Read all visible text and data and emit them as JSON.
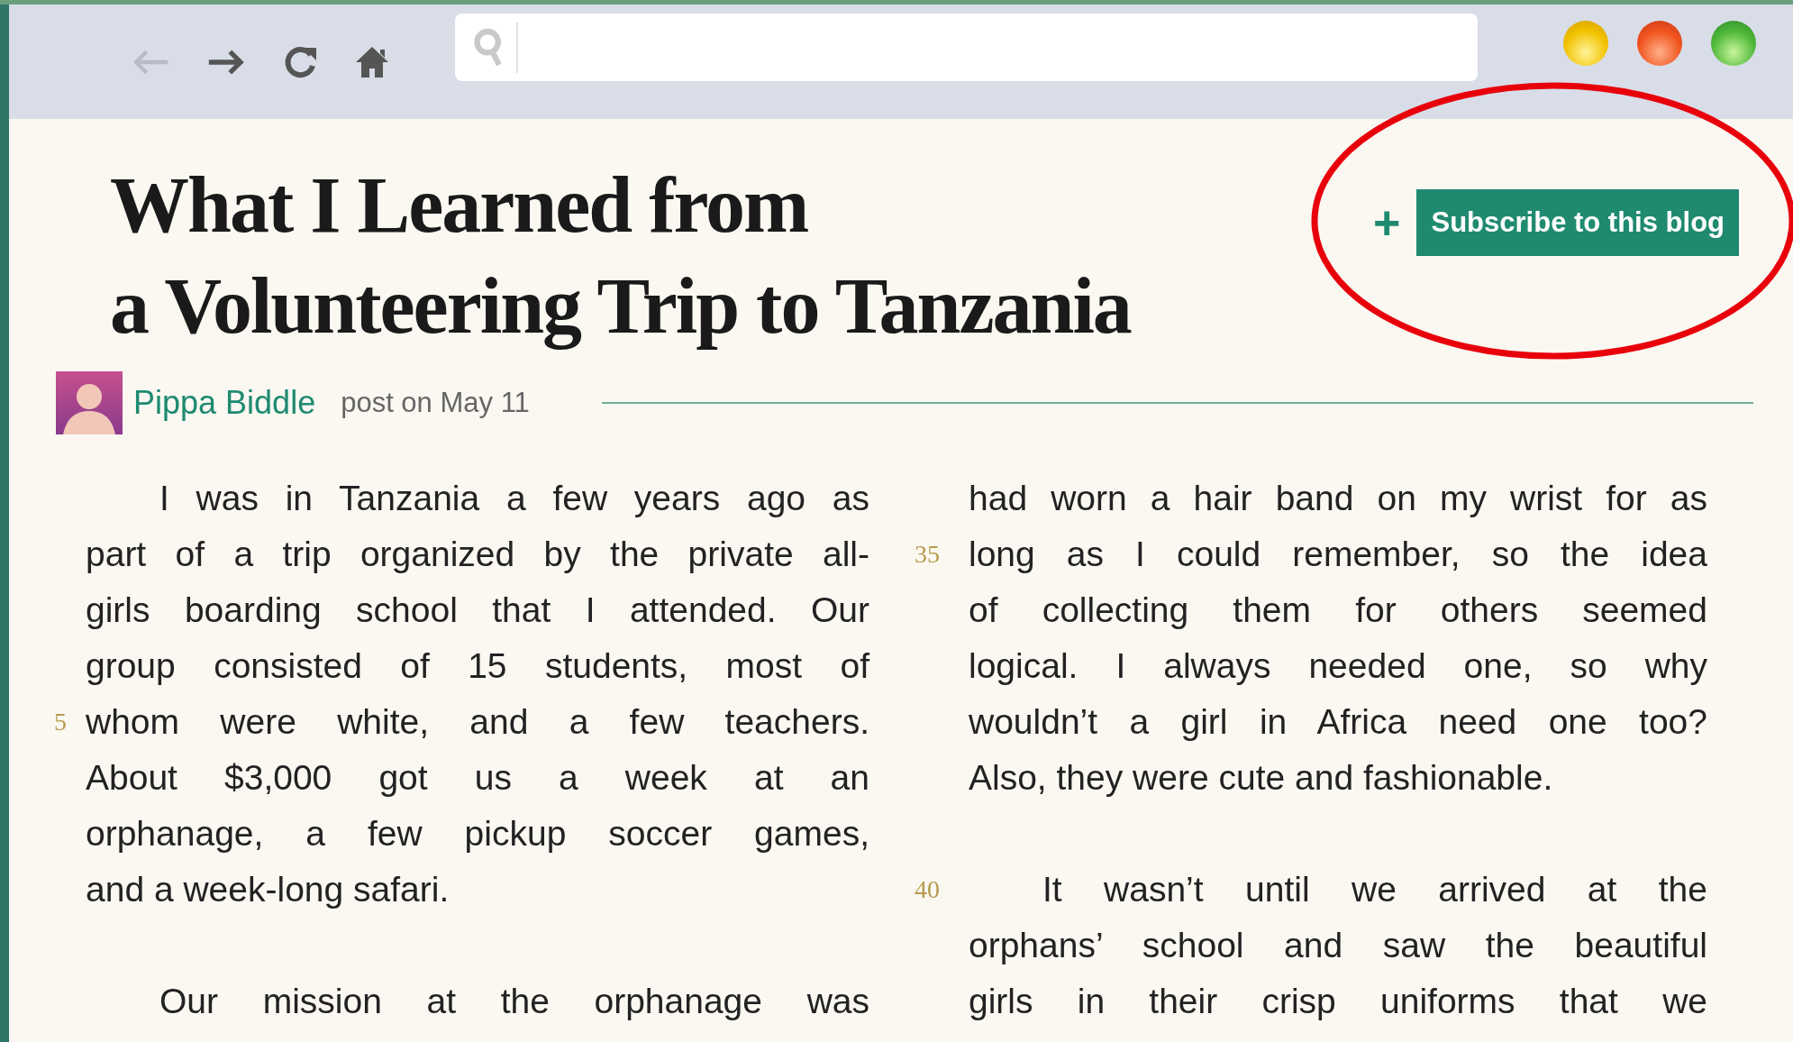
{
  "post": {
    "title_lines": [
      "What I Learned from",
      "a Volunteering Trip to Tanzania"
    ],
    "subscribe": {
      "plus": "+",
      "label": "Subscribe to this blog"
    },
    "author": "Pippa Biddle",
    "date": "post on May 11"
  },
  "columns": [
    {
      "lines": [
        {
          "kind": "line",
          "text": "I was in Tanzania a few years ago as",
          "indent": true
        },
        {
          "kind": "line",
          "text": "part of a trip organized by the private all-",
          "indent": false
        },
        {
          "kind": "line",
          "text": "girls boarding school that I attended. Our",
          "indent": false
        },
        {
          "kind": "line",
          "text": "group consisted of 15 students, most of",
          "indent": false
        },
        {
          "kind": "line",
          "text": "whom were white, and a few teachers.",
          "indent": false,
          "number": "5"
        },
        {
          "kind": "line",
          "text": "About $3,000 got us a week at an",
          "indent": false
        },
        {
          "kind": "line",
          "text": "orphanage, a few pickup soccer games,",
          "indent": false
        },
        {
          "kind": "line",
          "text": "and a week-long safari.",
          "indent": false,
          "last": true
        },
        {
          "kind": "gap"
        },
        {
          "kind": "line",
          "text": "Our mission at the orphanage was",
          "indent": true
        }
      ]
    },
    {
      "lines": [
        {
          "kind": "line",
          "text": "had worn a hair band on my wrist for as",
          "indent": false
        },
        {
          "kind": "line",
          "text": "long as I could remember, so the idea",
          "indent": false,
          "number": "35"
        },
        {
          "kind": "line",
          "text": "of collecting them for others seemed",
          "indent": false
        },
        {
          "kind": "line",
          "text": "logical. I always needed one, so why",
          "indent": false
        },
        {
          "kind": "line",
          "text": "wouldn’t a girl in Africa need one too?",
          "indent": false
        },
        {
          "kind": "line",
          "text": "Also, they were cute and fashionable.",
          "indent": false,
          "last": true
        },
        {
          "kind": "gap"
        },
        {
          "kind": "line",
          "text": "It wasn’t until we arrived at the",
          "indent": true,
          "number": "40"
        },
        {
          "kind": "line",
          "text": "orphans’ school and saw the beautiful",
          "indent": false
        },
        {
          "kind": "line",
          "text": "girls in their crisp uniforms that we",
          "indent": false
        }
      ]
    }
  ]
}
